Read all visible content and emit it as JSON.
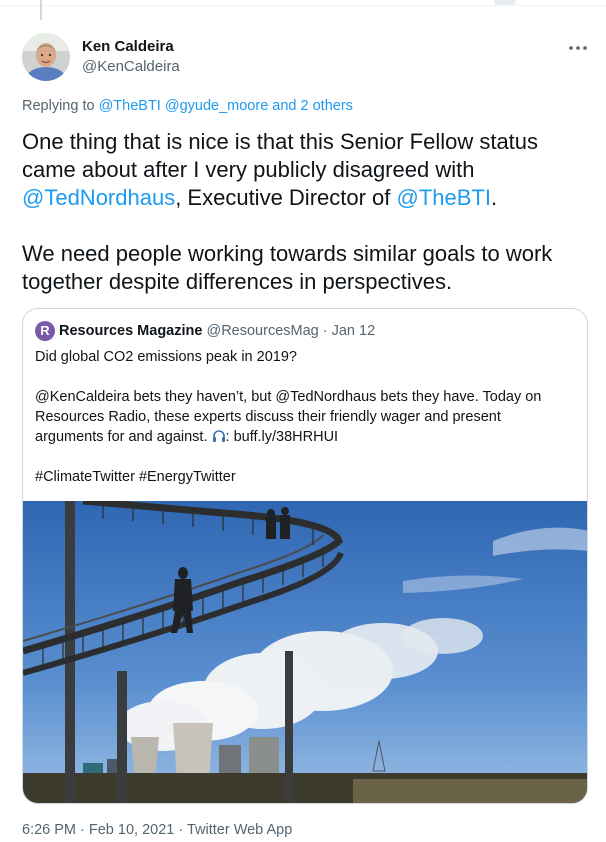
{
  "tweet": {
    "author_name": "Ken Caldeira",
    "author_handle": "@KenCaldeira",
    "more_icon": "more-horizontal-icon",
    "replying_prefix": "Replying to ",
    "replying_to": [
      "@TheBTI",
      "@gyude_moore"
    ],
    "replying_others": "and 2 others",
    "text": {
      "line1": "One thing that is nice is that this Senior Fellow status",
      "line2": "came about after I very publicly disagreed with",
      "mention1": "@TedNordhaus",
      "line3_mid": ", Executive Director of ",
      "mention2": "@TheBTI",
      "line3_end": ".",
      "line4": "We need people working towards similar goals to work",
      "line5": "together despite differences in perspectives."
    },
    "timestamp": "6:26 PM · Feb 10, 2021 · Twitter Web App"
  },
  "quoted": {
    "avatar_letter": "R",
    "name": "Resources Magazine",
    "handle": "@ResourcesMag",
    "date": "· Jan 12",
    "line1": "Did global CO2 emissions peak in 2019?",
    "line2": "@KenCaldeira bets they haven’t, but @TedNordhaus bets they have. Today on",
    "line3": "Resources Radio, these experts discuss their friendly wager and present",
    "line4_pre": "arguments for and against. ",
    "line4_link": ": buff.ly/38HRHUI",
    "hashtags": "#ClimateTwitter #EnergyTwitter",
    "image_icon": "staircase-photo"
  },
  "colors": {
    "link": "#1d9bf0",
    "text": "#0f1419",
    "muted": "#536471",
    "border": "#cfd9de"
  }
}
